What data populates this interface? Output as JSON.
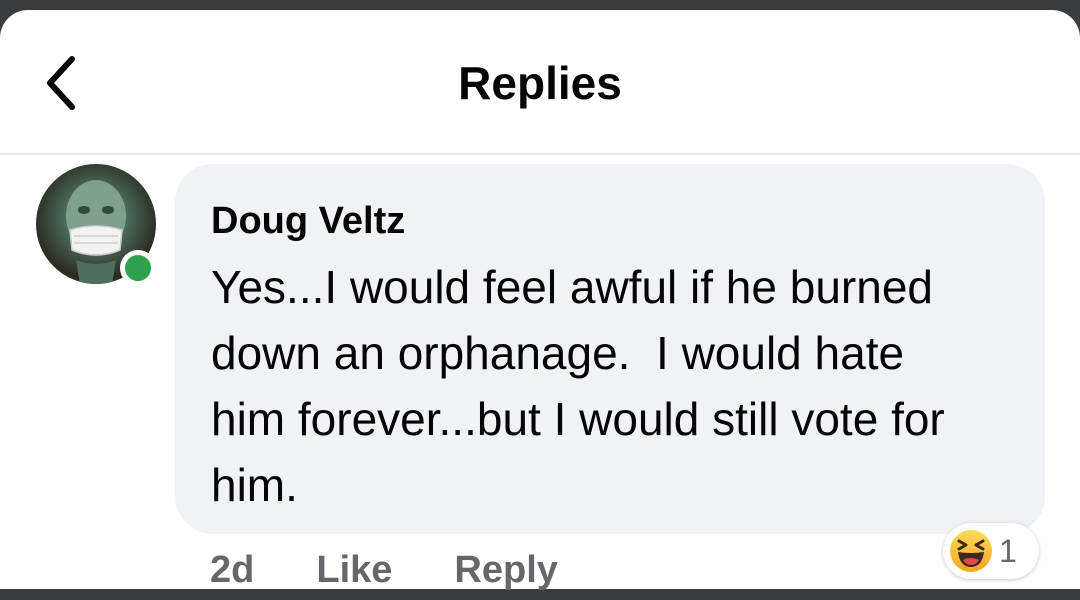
{
  "header": {
    "title": "Replies",
    "back_icon": "chevron-left-icon"
  },
  "comment": {
    "author": "Doug Veltz",
    "text": "Yes...I would feel awful if he burned down an orphanage.  I would hate him forever...but I would still vote for him.",
    "online": true,
    "online_color": "#31a24c",
    "avatar": "avatar-masked-figure"
  },
  "meta": {
    "time": "2d",
    "like_label": "Like",
    "reply_label": "Reply"
  },
  "reactions": {
    "icon": "haha-emoji-icon",
    "count": "1"
  }
}
